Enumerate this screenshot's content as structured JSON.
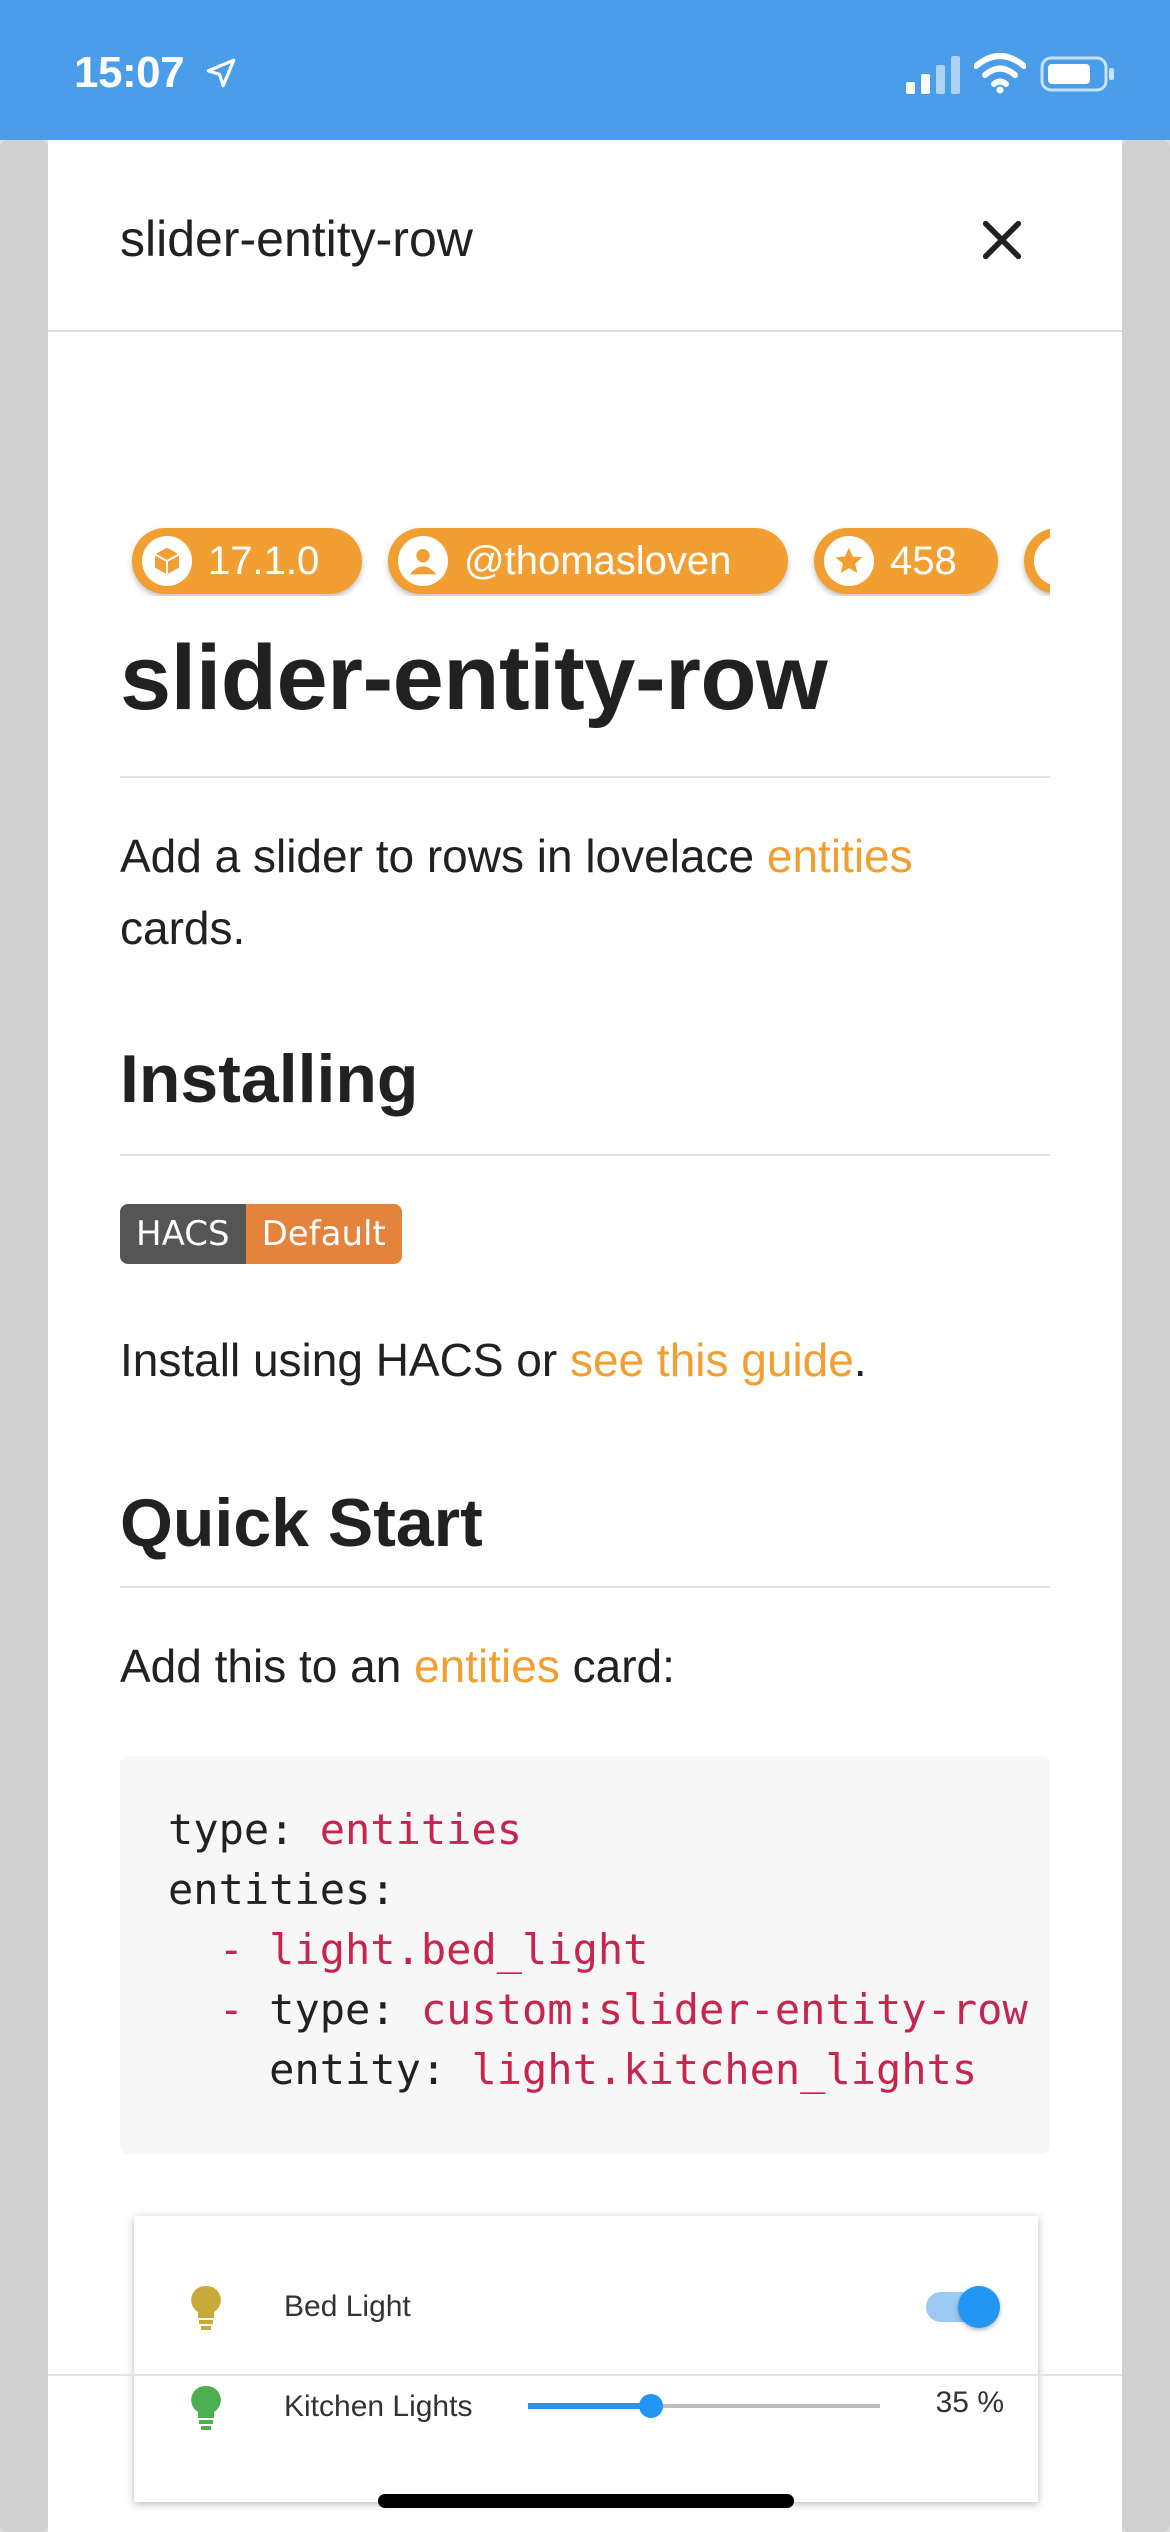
{
  "status_bar": {
    "time": "15:07",
    "bg_color": "#4a9de8"
  },
  "dialog": {
    "title": "slider-entity-row",
    "close_icon": "close-icon"
  },
  "badges": [
    {
      "icon": "package-icon",
      "label": "17.1.0"
    },
    {
      "icon": "account-icon",
      "label": "@thomasloven"
    },
    {
      "icon": "star-icon",
      "label": "458"
    }
  ],
  "readme": {
    "h1": "slider-entity-row",
    "intro_before": "Add a slider to rows in lovelace ",
    "intro_link": "entities",
    "intro_after": " cards.",
    "installing_heading": "Installing",
    "hacs_badge_left": "HACS",
    "hacs_badge_right": "Default",
    "install_before": "Install using HACS or ",
    "install_link": "see this guide",
    "install_after": ".",
    "quickstart_heading": "Quick Start",
    "quick_before": "Add this to an ",
    "quick_link": "entities",
    "quick_after": " card:"
  },
  "code": {
    "l1_key": "type: ",
    "l1_val": "entities",
    "l2_key": "entities:",
    "l3_dash": "  - ",
    "l3_val": "light.bed_light",
    "l4_dash": "  - ",
    "l4_key": "type: ",
    "l4_val": "custom:slider-entity-row",
    "l5_key": "    entity: ",
    "l5_val": "light.kitchen_lights"
  },
  "preview": {
    "row1_label": "Bed Light",
    "row1_state": "on",
    "row2_label": "Kitchen Lights",
    "row2_percent": 35,
    "row2_value_text": "35 %",
    "bulb1_color": "#c9a93a",
    "bulb2_color": "#4caf50",
    "accent": "#2196f3"
  },
  "link_color": "#f19f33"
}
